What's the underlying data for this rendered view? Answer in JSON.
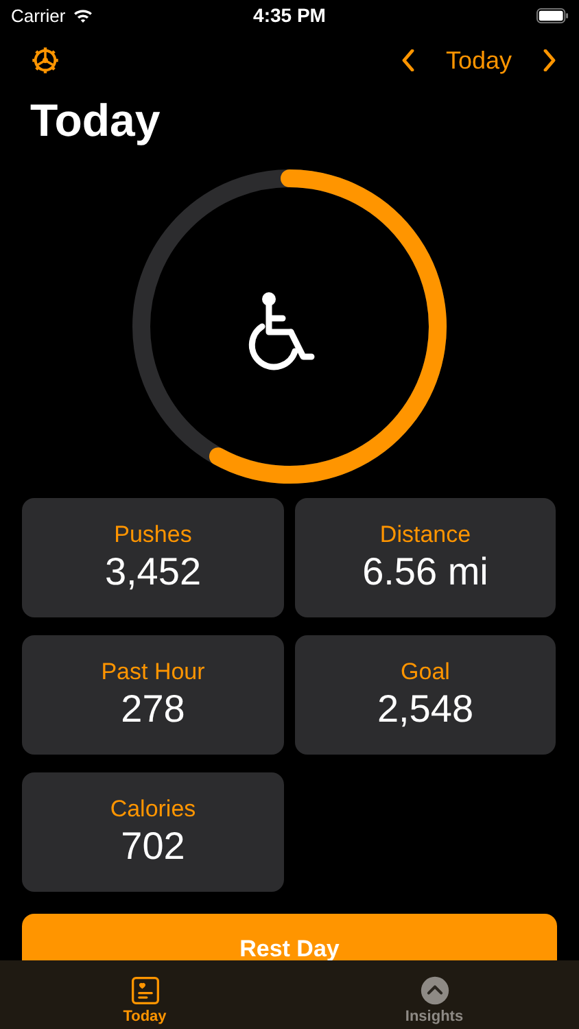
{
  "status_bar": {
    "carrier": "Carrier",
    "time": "4:35 PM"
  },
  "nav": {
    "date_label": "Today"
  },
  "title": "Today",
  "stats": [
    {
      "label": "Pushes",
      "value": "3,452"
    },
    {
      "label": "Distance",
      "value": "6.56 mi"
    },
    {
      "label": "Past Hour",
      "value": "278"
    },
    {
      "label": "Goal",
      "value": "2,548"
    },
    {
      "label": "Calories",
      "value": "702"
    }
  ],
  "action_button": "Rest Day",
  "tabs": [
    {
      "label": "Today",
      "kind": "journal",
      "selected": true
    },
    {
      "label": "Insights",
      "kind": "chevron",
      "selected": false
    }
  ]
}
